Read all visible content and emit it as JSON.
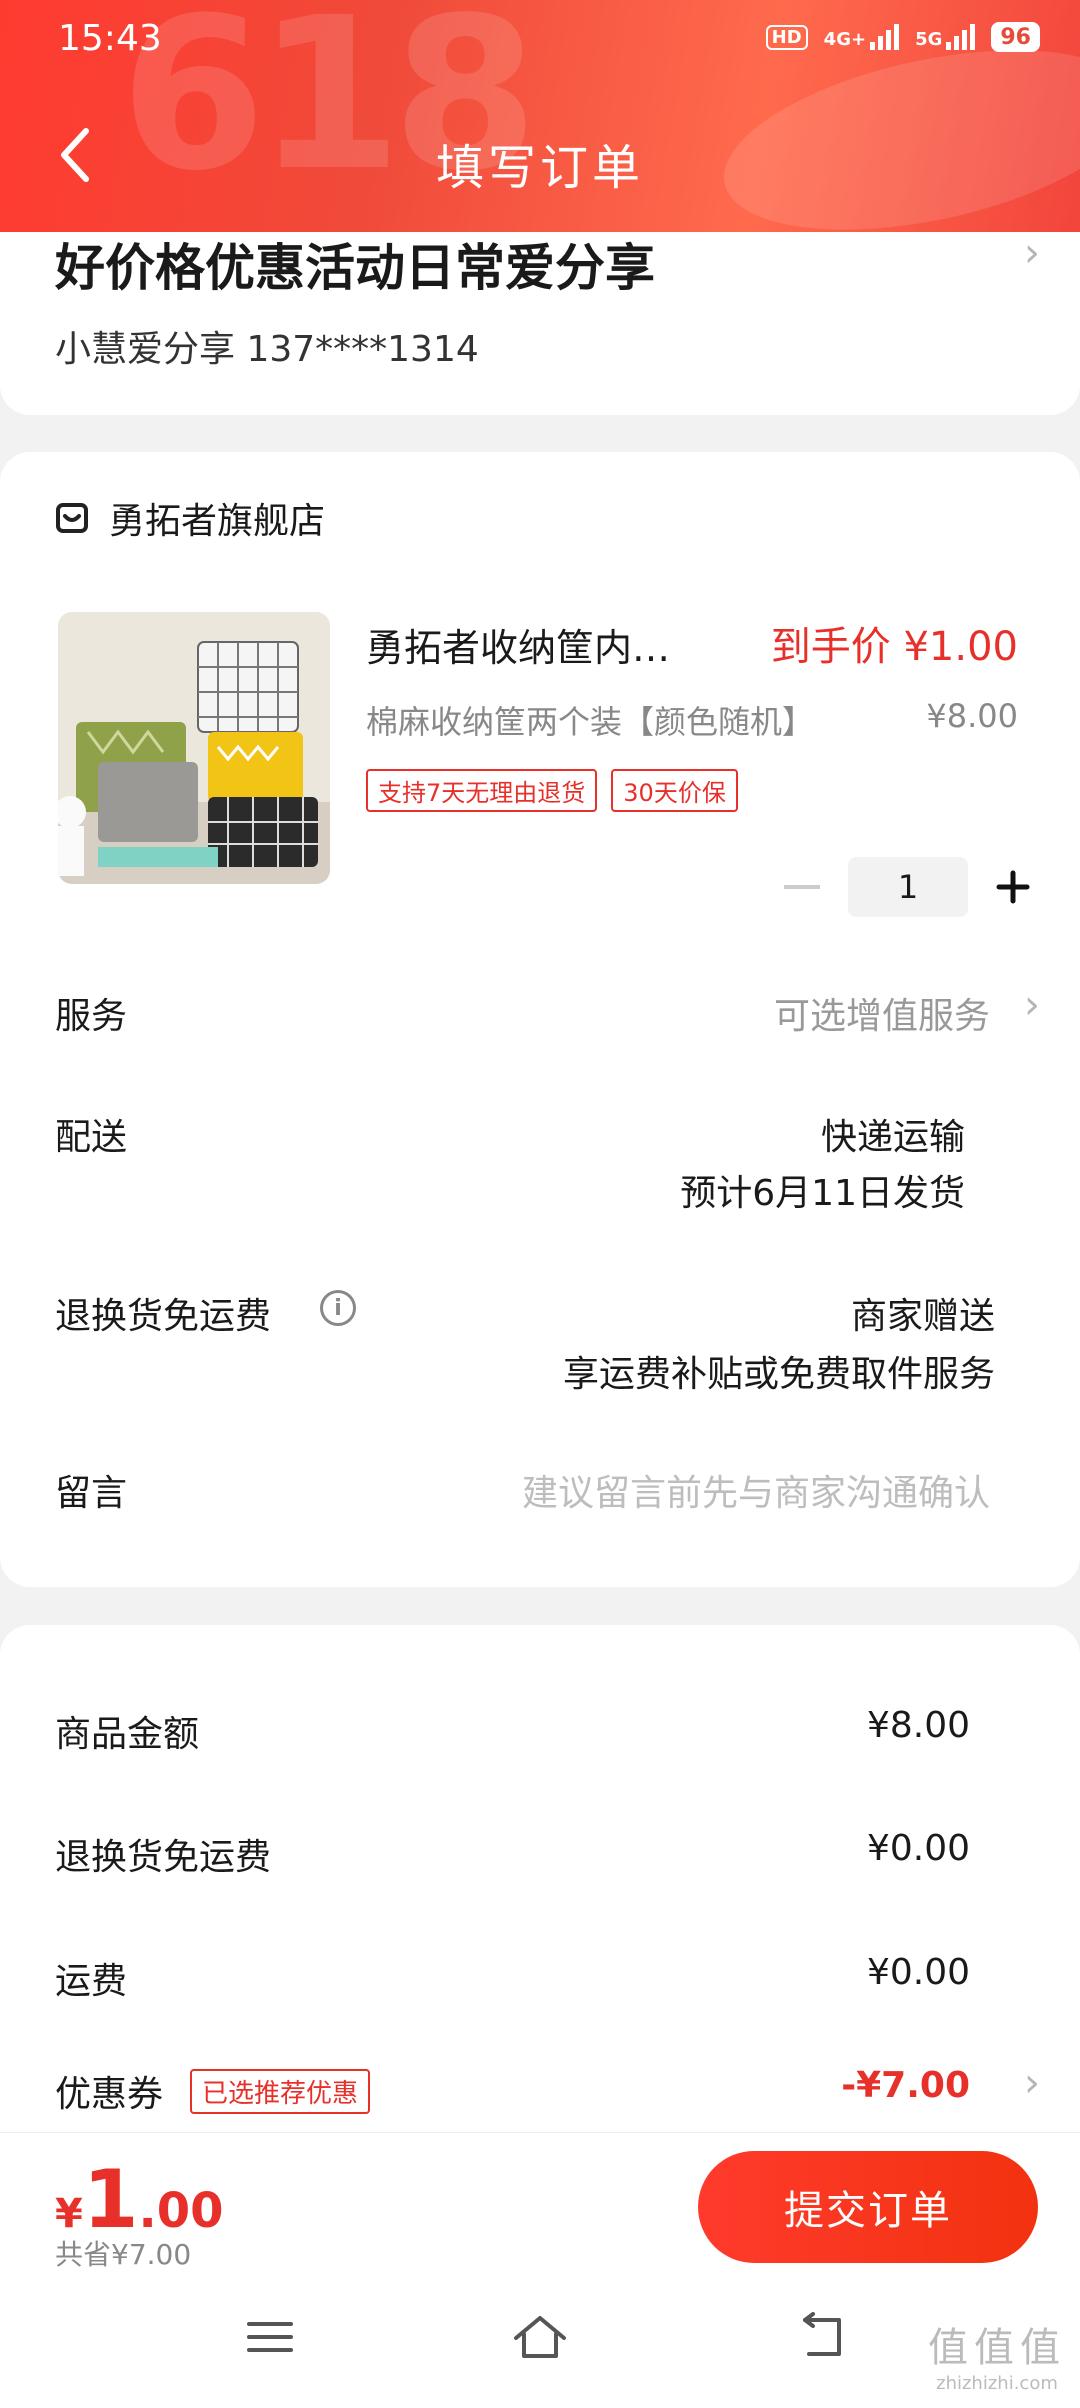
{
  "status": {
    "time": "15:43",
    "hd": "HD",
    "net1": "4G+",
    "net2": "5G",
    "battery": "96"
  },
  "header": {
    "title": "填写订单",
    "bg_text": "618"
  },
  "address": {
    "title": "好价格优惠活动日常爱分享",
    "contact": "小慧爱分享  137****1314"
  },
  "shop": {
    "name": "勇拓者旗舰店"
  },
  "product": {
    "title": "勇拓者收纳筐内…",
    "price_label": "到手价 ¥1.00",
    "spec": "棉麻收纳筐两个装【颜色随机】",
    "orig_price": "¥8.00",
    "tags": [
      "支持7天无理由退货",
      "30天价保"
    ],
    "qty": "1"
  },
  "rows": {
    "service_label": "服务",
    "service_value": "可选增值服务",
    "delivery_label": "配送",
    "delivery_value1": "快递运输",
    "delivery_value2": "预计6月11日发货",
    "return_label": "退换货免运费",
    "return_value1": "商家赠送",
    "return_value2": "享运费补贴或免费取件服务",
    "message_label": "留言",
    "message_placeholder": "建议留言前先与商家沟通确认"
  },
  "summary": {
    "goods_label": "商品金额",
    "goods_value": "¥8.00",
    "return_fee_label": "退换货免运费",
    "return_fee_value": "¥0.00",
    "shipping_label": "运费",
    "shipping_value": "¥0.00",
    "coupon_label": "优惠券",
    "coupon_badge": "已选推荐优惠",
    "coupon_value": "-¥7.00"
  },
  "bottom": {
    "yen": "¥",
    "total_int": "1",
    "total_dec": ".00",
    "saved": "共省¥7.00",
    "submit": "提交订单"
  },
  "watermark": {
    "mark": "值值值",
    "text": "zhizhizhi.com"
  },
  "colors": {
    "accent": "#e8302b",
    "header_start": "#ff3b30",
    "header_end": "#f2453c"
  }
}
